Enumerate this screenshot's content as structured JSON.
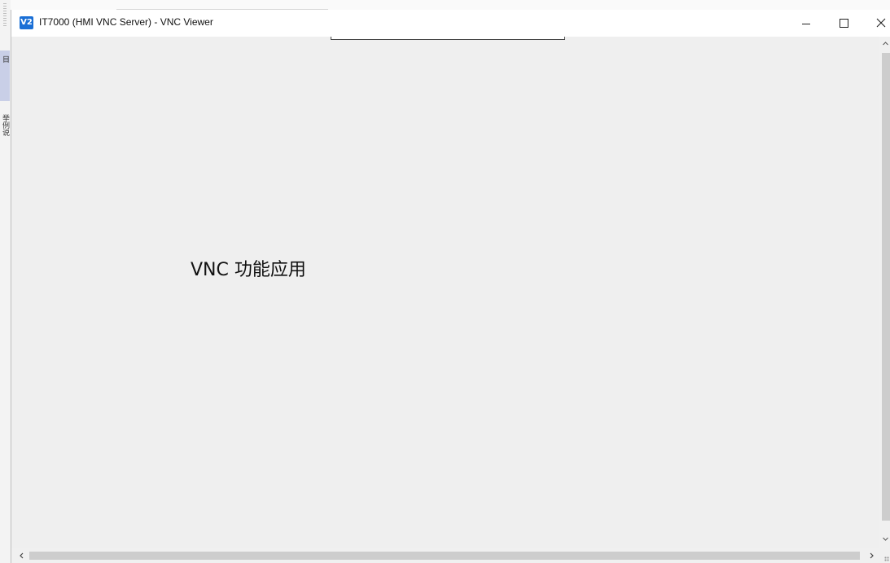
{
  "window": {
    "title": "IT7000 (HMI VNC Server) - VNC Viewer",
    "app_icon": "V2"
  },
  "controls": {
    "minimize": "minimize-icon",
    "maximize": "maximize-icon",
    "close": "close-icon"
  },
  "left_panel": {
    "tab_a": "目",
    "tab_b": "举例说"
  },
  "content": {
    "label": "VNC 功能应用"
  },
  "colors": {
    "accent": "#1a6fd6",
    "background": "#efefef",
    "scrollbar_thumb": "#cdcdcd"
  }
}
